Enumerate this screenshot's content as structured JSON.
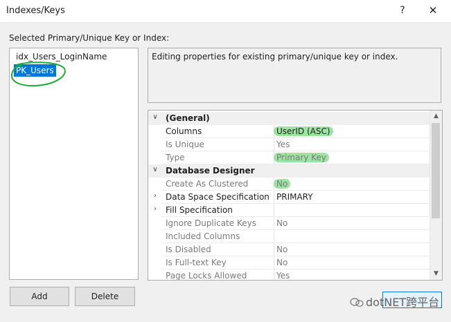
{
  "window": {
    "title": "Indexes/Keys",
    "help_glyph": "?",
    "close_glyph": "✕"
  },
  "selected_label": "Selected Primary/Unique Key or Index:",
  "list": {
    "items": [
      {
        "label": "idx_Users_LoginName",
        "selected": false
      },
      {
        "label": "PK_Users",
        "selected": true
      }
    ]
  },
  "description": "Editing properties for existing primary/unique key or index.",
  "properties": {
    "general": {
      "label": "(General)",
      "rows": [
        {
          "name": "Columns",
          "value": "UserID (ASC)",
          "dim": false
        },
        {
          "name": "Is Unique",
          "value": "Yes",
          "dim": true
        },
        {
          "name": "Type",
          "value": "Primary Key",
          "dim": true
        }
      ]
    },
    "designer": {
      "label": "Database Designer",
      "rows": [
        {
          "name": "Create As Clustered",
          "value": "No",
          "dim": true
        },
        {
          "name": "Data Space Specification",
          "value": "PRIMARY",
          "dim": false
        },
        {
          "name": "Fill Specification",
          "value": "",
          "dim": false
        },
        {
          "name": "Ignore Duplicate Keys",
          "value": "No",
          "dim": true
        },
        {
          "name": "Included Columns",
          "value": "",
          "dim": true
        },
        {
          "name": "Is Disabled",
          "value": "No",
          "dim": true
        },
        {
          "name": "Is Full-text Key",
          "value": "No",
          "dim": true
        },
        {
          "name": "Page Locks Allowed",
          "value": "Yes",
          "dim": true
        }
      ]
    }
  },
  "buttons": {
    "add": "Add",
    "delete": "Delete"
  },
  "watermark": "dotNET跨平台",
  "colors": {
    "selection": "#0078d7",
    "highlight": "#9ee3a3",
    "annotation_circle": "#1faa3c"
  }
}
